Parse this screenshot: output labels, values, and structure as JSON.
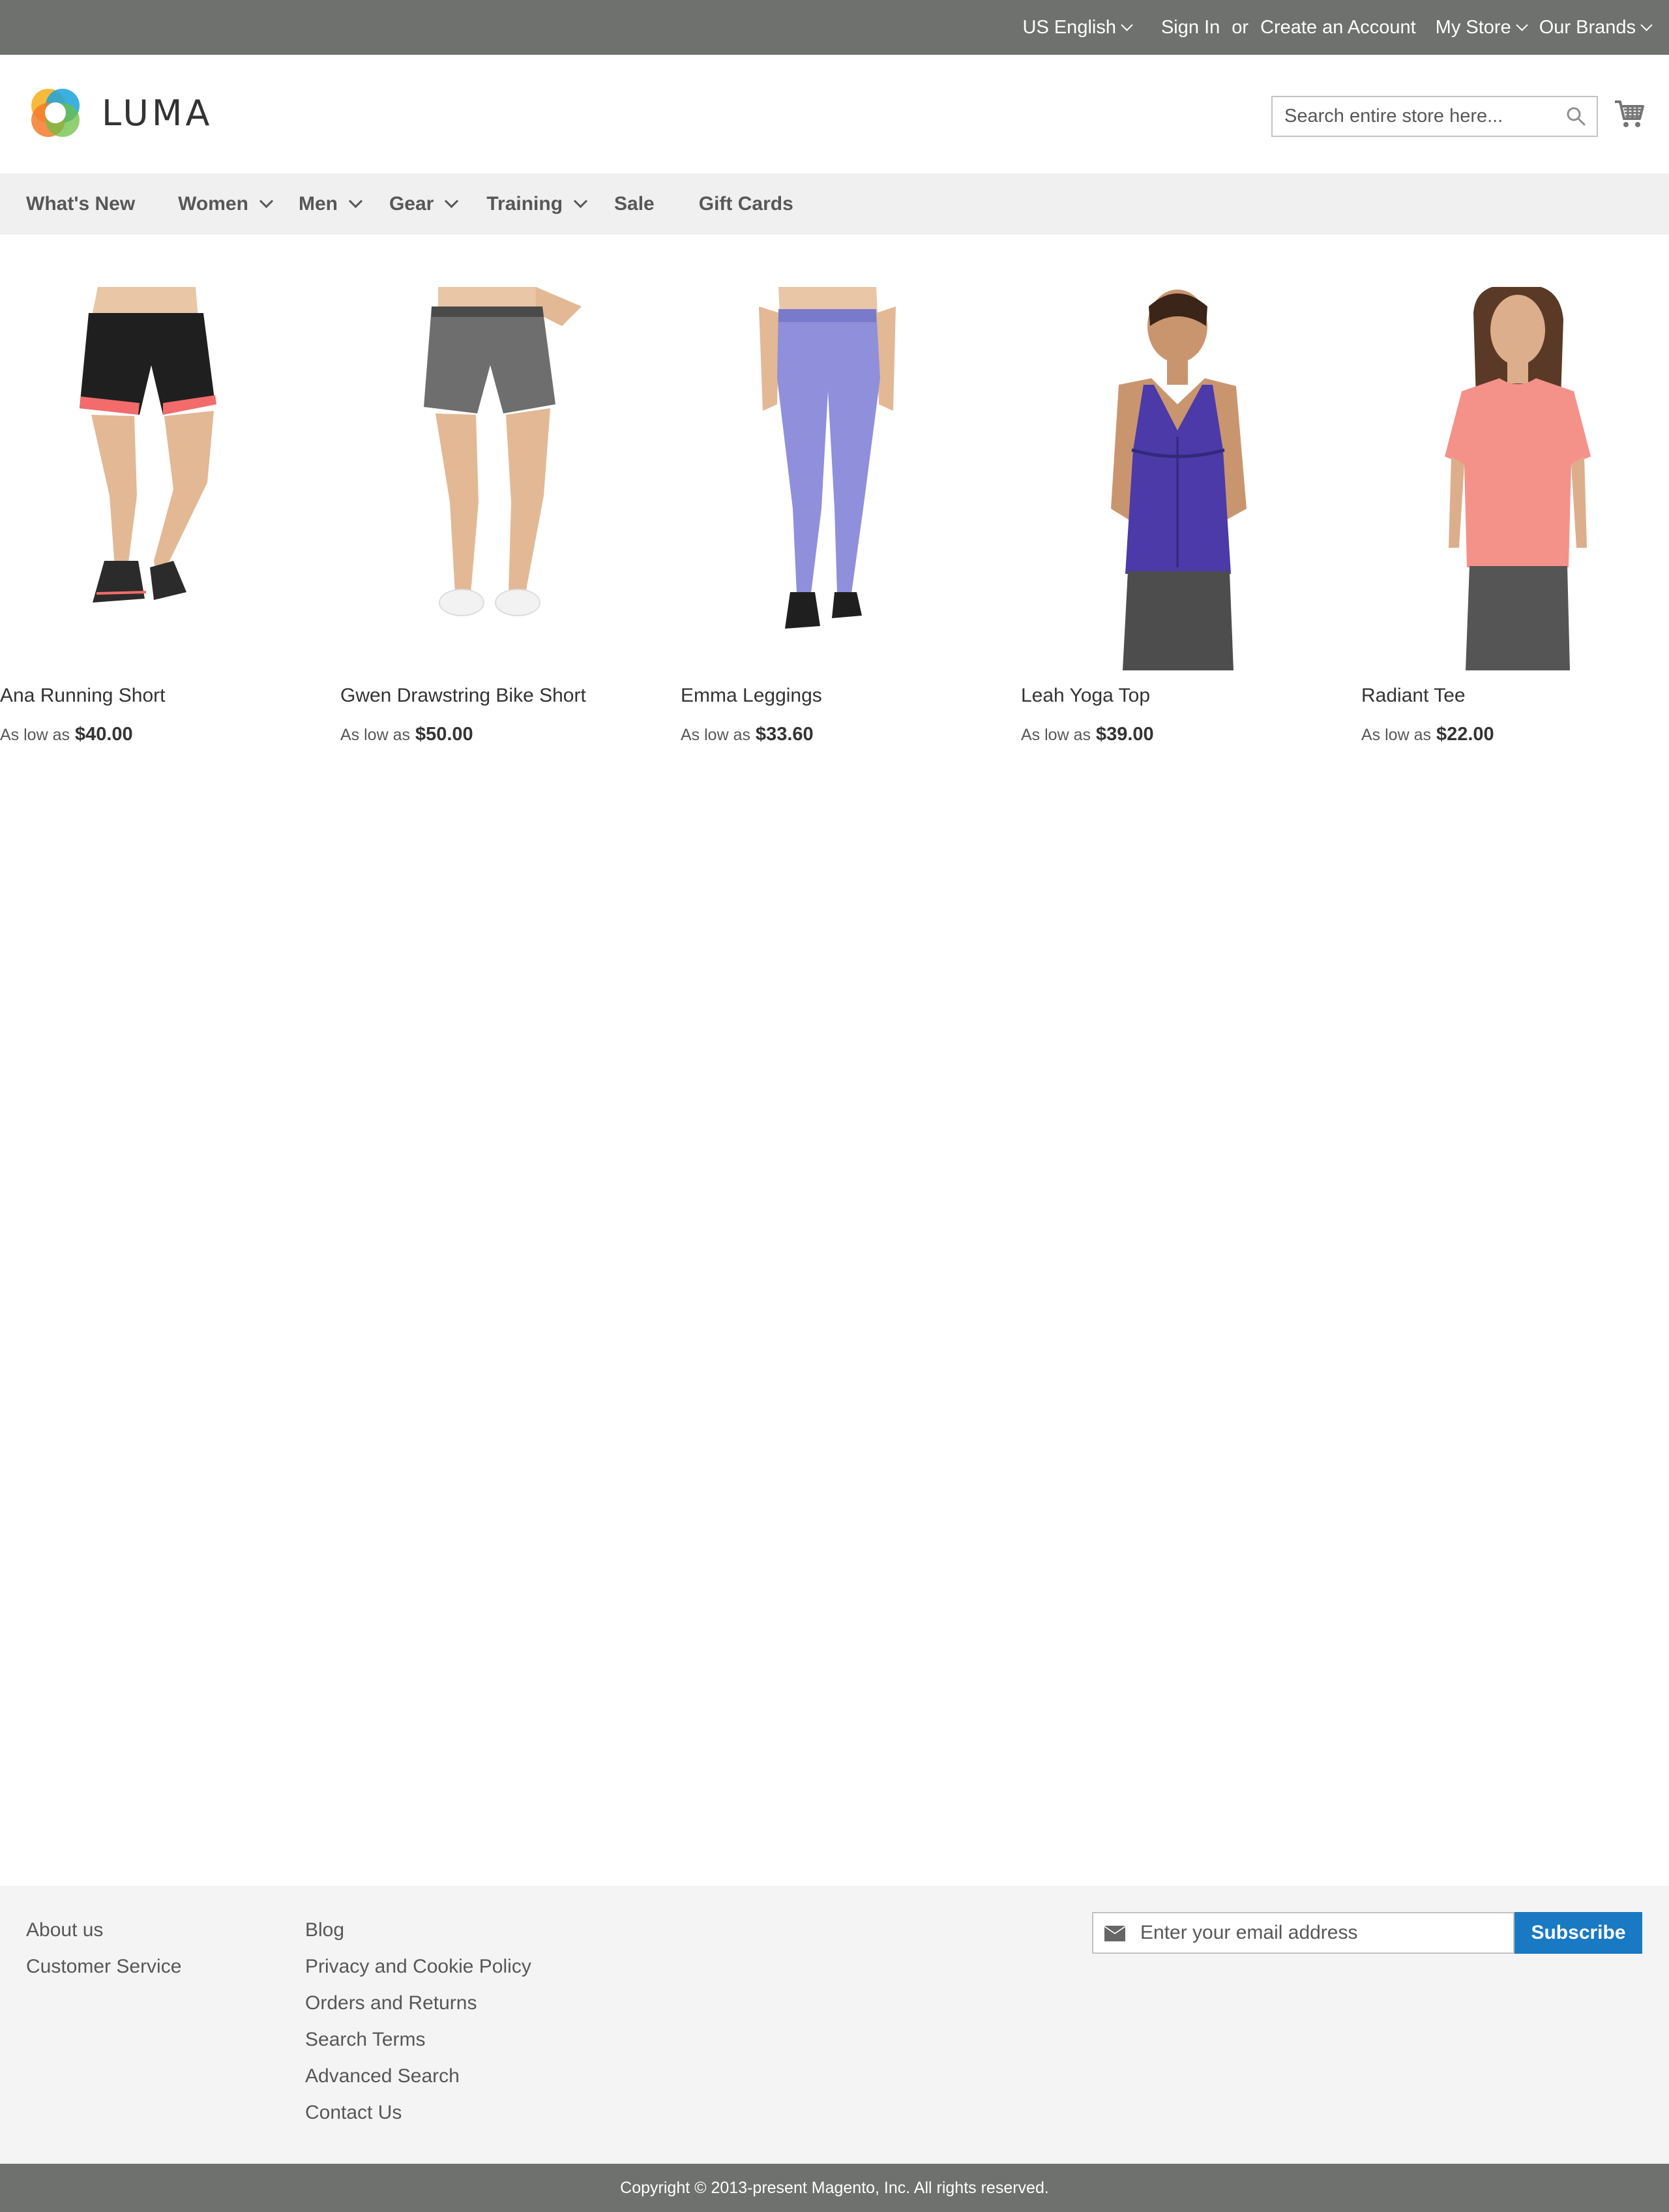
{
  "topbar": {
    "language": "US English",
    "sign_in": "Sign In",
    "or": "or",
    "create_account": "Create an Account",
    "my_store": "My Store",
    "our_brands": "Our Brands"
  },
  "header": {
    "logo_text": "LUMA",
    "search_placeholder": "Search entire store here...",
    "search_icon": "search-icon",
    "cart_icon": "cart-icon"
  },
  "nav": {
    "items": [
      {
        "label": "What's New",
        "has_dropdown": false
      },
      {
        "label": "Women",
        "has_dropdown": true
      },
      {
        "label": "Men",
        "has_dropdown": true
      },
      {
        "label": "Gear",
        "has_dropdown": true
      },
      {
        "label": "Training",
        "has_dropdown": true
      },
      {
        "label": "Sale",
        "has_dropdown": false
      },
      {
        "label": "Gift Cards",
        "has_dropdown": false
      }
    ]
  },
  "products": [
    {
      "name": "Ana Running Short",
      "price_label": "As low as",
      "price": "$40.00"
    },
    {
      "name": "Gwen Drawstring Bike Short",
      "price_label": "As low as",
      "price": "$50.00"
    },
    {
      "name": "Emma Leggings",
      "price_label": "As low as",
      "price": "$33.60"
    },
    {
      "name": "Leah Yoga Top",
      "price_label": "As low as",
      "price": "$39.00"
    },
    {
      "name": "Radiant Tee",
      "price_label": "As low as",
      "price": "$22.00"
    }
  ],
  "footer": {
    "col1": [
      "About us",
      "Customer Service"
    ],
    "col2": [
      "Blog",
      "Privacy and Cookie Policy",
      "Orders and Returns",
      "Search Terms",
      "Advanced Search",
      "Contact Us"
    ],
    "newsletter_placeholder": "Enter your email address",
    "subscribe": "Subscribe",
    "copyright": "Copyright © 2013-present Magento, Inc. All rights reserved."
  },
  "colors": {
    "topbar_bg": "#6e716e",
    "nav_bg": "#f0f0f0",
    "footer_bg": "#f4f4f4",
    "accent": "#1979c3"
  }
}
